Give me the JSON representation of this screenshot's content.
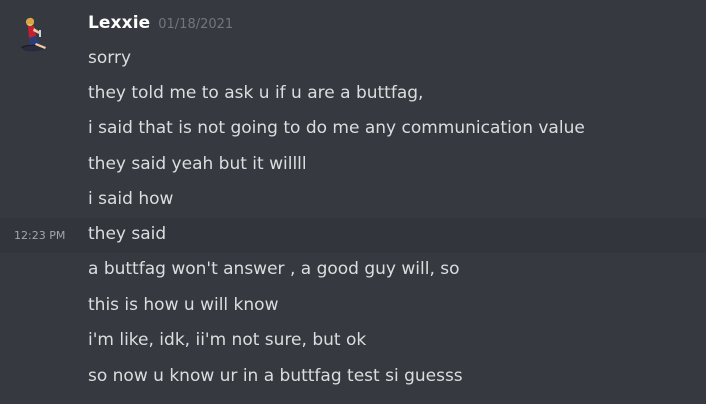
{
  "author": {
    "name": "Lexxie",
    "date": "01/18/2021"
  },
  "hover_time": "12:23 PM",
  "messages": [
    "sorry",
    "they told me to ask u if  u are a buttfag,",
    "i said that is not going to do me any communication value",
    "they said yeah but it willll",
    "i said how",
    "they said",
    "a buttfag won't answer , a good guy will, so",
    "this is how u will know",
    "i'm like, idk, ii'm not sure, but ok",
    "so now u know ur in a buttfag test si guesss"
  ],
  "colors": {
    "background": "#36393f",
    "hover_background": "#32353b",
    "username": "#ffffff",
    "text": "#dcddde",
    "muted": "#72767d"
  }
}
